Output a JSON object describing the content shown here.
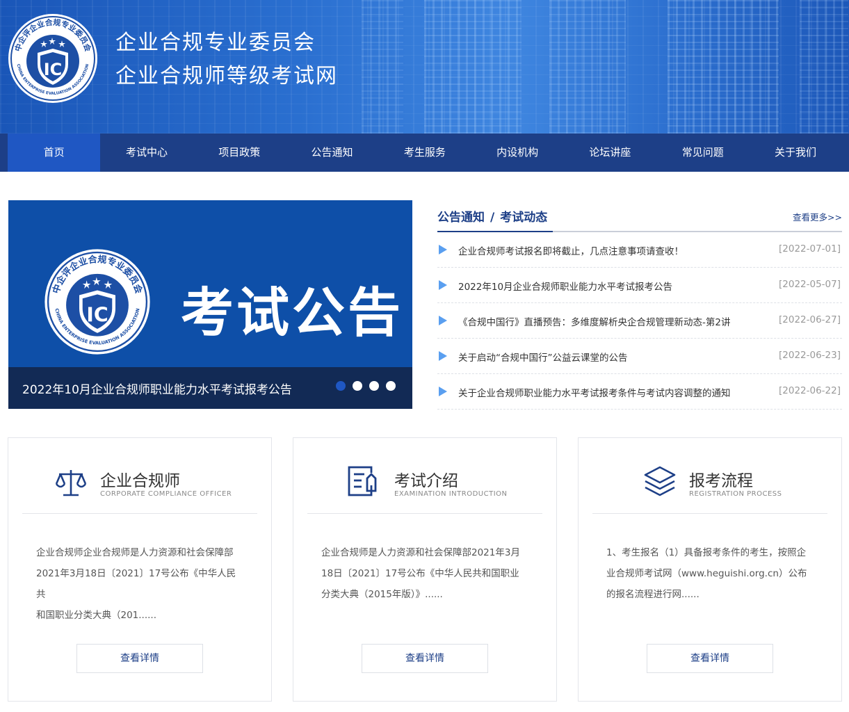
{
  "header": {
    "logo": {
      "ring_text": "中企评企业合规专业委员会",
      "en_text": "CHINA ENTERPRISE EVALUATION ASSOCIATION",
      "emblem": "IC"
    },
    "title_line1": "企业合规专业委员会",
    "title_line2": "企业合规师等级考试网"
  },
  "nav": {
    "items": [
      "首页",
      "考试中心",
      "项目政策",
      "公告通知",
      "考生服务",
      "内设机构",
      "论坛讲座",
      "常见问题",
      "关于我们"
    ],
    "active_index": 0
  },
  "slider": {
    "big_text": "考试公告",
    "caption": "2022年10月企业合规师职业能力水平考试报考公告",
    "dots": 4,
    "active_dot": 0
  },
  "notices": {
    "tab1": "公告通知",
    "separator": "/",
    "tab2": "考试动态",
    "more": "查看更多>>",
    "items": [
      {
        "title": "企业合规师考试报名即将截止，几点注意事项请查收！",
        "date": "[2022-07-01]"
      },
      {
        "title": "2022年10月企业合规师职业能力水平考试报考公告",
        "date": "[2022-05-07]"
      },
      {
        "title": "《合规中国行》直播预告：多维度解析央企合规管理新动态-第2讲",
        "date": "[2022-06-27]"
      },
      {
        "title": "关于启动“合规中国行”公益云课堂的公告",
        "date": "[2022-06-23]"
      },
      {
        "title": "关于企业合规师职业能力水平考试报考条件与考试内容调整的通知",
        "date": "[2022-06-22]"
      }
    ]
  },
  "cards": [
    {
      "icon": "scale-icon",
      "title": "企业合规师",
      "subtitle": "CORPORATE COMPLIANCE OFFICER",
      "body": [
        "企业合规师企业合规师是人力资源和社会保障部",
        "2021年3月18日〔2021〕17号公布《中华人民共",
        "和国职业分类大典（201......"
      ],
      "button": "查看详情"
    },
    {
      "icon": "document-edit-icon",
      "title": "考试介绍",
      "subtitle": "EXAMINATION INTRODUCTION",
      "body": [
        "企业合规师是人力资源和社会保障部2021年3月",
        "18日〔2021〕17号公布《中华人民共和国职业",
        "分类大典（2015年版）》......"
      ],
      "button": "查看详情"
    },
    {
      "icon": "layers-icon",
      "title": "报考流程",
      "subtitle": "REGISTRATION PROCESS",
      "body": [
        "1、考生报名（1）具备报考条件的考生，按照企",
        "业合规师考试网（www.heguishi.org.cn）公布",
        "的报名流程进行网......"
      ],
      "button": "查看详情"
    }
  ],
  "colors": {
    "nav_bg": "#1d3f87",
    "nav_active": "#1f57c3",
    "slide_bg": "#0e4fa8",
    "caption_bg": "#122a55",
    "accent_triangle": "#5a9ff0"
  }
}
